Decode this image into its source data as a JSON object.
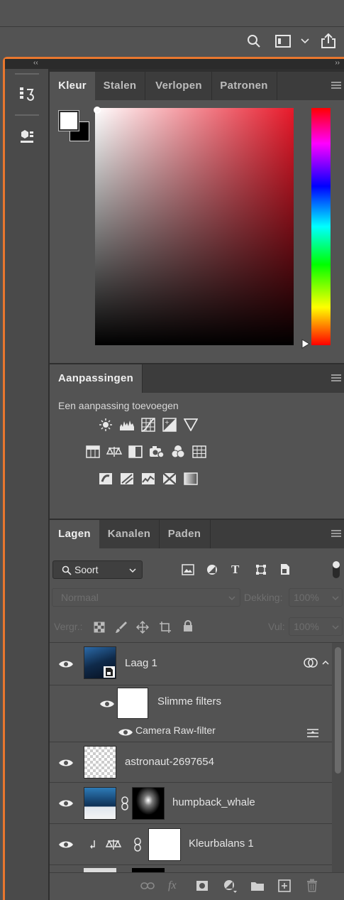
{
  "colors": {
    "accent": "#e9772e"
  },
  "appbar": {
    "search_icon": "search-icon",
    "layout_icon": "workspace-layout-icon",
    "share_icon": "share-icon"
  },
  "collapse": {
    "left": "‹‹",
    "right": "››"
  },
  "color_panel": {
    "tabs": [
      "Kleur",
      "Stalen",
      "Verlopen",
      "Patronen"
    ],
    "active_tab": "Kleur",
    "foreground": "#ffffff",
    "background": "#000000",
    "hue_color": "#e8192a"
  },
  "adjustments": {
    "tab": "Aanpassingen",
    "subtitle": "Een aanpassing toevoegen"
  },
  "layers_panel": {
    "tabs": [
      "Lagen",
      "Kanalen",
      "Paden"
    ],
    "filter_label": "Soort",
    "blend_mode": "Normaal",
    "opacity_label": "Dekking:",
    "opacity_value": "100%",
    "lock_label": "Vergr.:",
    "fill_label": "Vul:",
    "fill_value": "100%",
    "layers": [
      {
        "name": "Laag 1"
      },
      {
        "name": "Slimme filters"
      },
      {
        "name": "Camera Raw-filter"
      },
      {
        "name": "astronaut-2697654"
      },
      {
        "name": "humpback_whale"
      },
      {
        "name": "Kleurbalans 1"
      }
    ]
  }
}
